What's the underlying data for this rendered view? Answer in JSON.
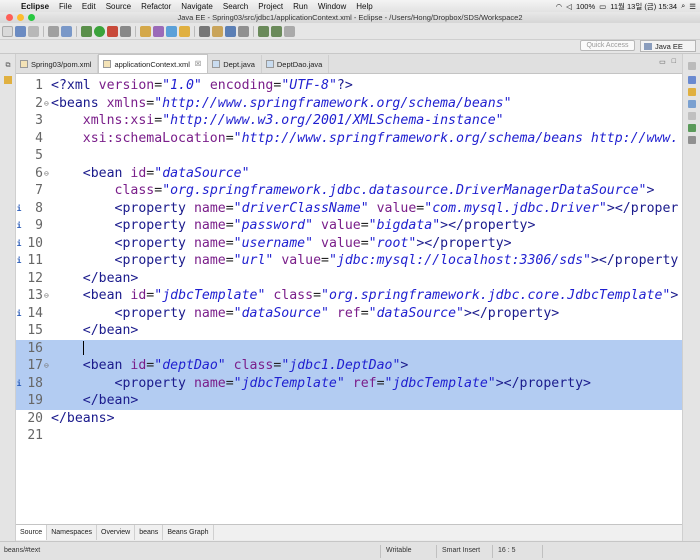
{
  "menubar": {
    "items": [
      "Eclipse",
      "File",
      "Edit",
      "Source",
      "Refactor",
      "Navigate",
      "Search",
      "Project",
      "Run",
      "Window",
      "Help"
    ],
    "battery": "100%",
    "datetime": "11월 13일 (금)  15:34"
  },
  "window": {
    "title": "Java EE - Spring03/src/jdbc1/applicationContext.xml - Eclipse - /Users/Hong/Dropbox/SDS/Workspace2"
  },
  "toolbar": {
    "quick_access_placeholder": "Quick Access",
    "perspective": "Java EE"
  },
  "tabs": [
    {
      "label": "Spring03/pom.xml",
      "icon": "xml-file-icon",
      "active": false
    },
    {
      "label": "applicationContext.xml",
      "icon": "xml-file-icon",
      "active": true,
      "close": "☒"
    },
    {
      "label": "Dept.java",
      "icon": "java-file-icon",
      "active": false
    },
    {
      "label": "DeptDao.java",
      "icon": "java-file-icon",
      "active": false
    }
  ],
  "editor": {
    "lines": [
      {
        "n": "1",
        "fold": "",
        "marker": "",
        "sel": false,
        "code": [
          [
            "tg",
            "<?xml "
          ],
          [
            "at",
            "version"
          ],
          [
            "tx",
            "="
          ],
          [
            "vl",
            "\"1.0\""
          ],
          [
            "tx",
            " "
          ],
          [
            "at",
            "encoding"
          ],
          [
            "tx",
            "="
          ],
          [
            "vl",
            "\"UTF-8\""
          ],
          [
            "tg",
            "?>"
          ]
        ]
      },
      {
        "n": "2",
        "fold": "⊖",
        "marker": "",
        "sel": false,
        "code": [
          [
            "tg",
            "<beans "
          ],
          [
            "at",
            "xmlns"
          ],
          [
            "tx",
            "="
          ],
          [
            "vl",
            "\"http://www.springframework.org/schema/beans\""
          ]
        ]
      },
      {
        "n": "3",
        "fold": "",
        "marker": "",
        "sel": false,
        "code": [
          [
            "tx",
            "    "
          ],
          [
            "at",
            "xmlns:xsi"
          ],
          [
            "tx",
            "="
          ],
          [
            "vl",
            "\"http://www.w3.org/2001/XMLSchema-instance\""
          ]
        ]
      },
      {
        "n": "4",
        "fold": "",
        "marker": "",
        "sel": false,
        "code": [
          [
            "tx",
            "    "
          ],
          [
            "at",
            "xsi:schemaLocation"
          ],
          [
            "tx",
            "="
          ],
          [
            "vl",
            "\"http://www.springframework.org/schema/beans http://www."
          ]
        ]
      },
      {
        "n": "5",
        "fold": "",
        "marker": "",
        "sel": false,
        "code": []
      },
      {
        "n": "6",
        "fold": "⊖",
        "marker": "",
        "sel": false,
        "code": [
          [
            "tx",
            "    "
          ],
          [
            "tg",
            "<bean "
          ],
          [
            "at",
            "id"
          ],
          [
            "tx",
            "="
          ],
          [
            "vl",
            "\"dataSource\""
          ]
        ]
      },
      {
        "n": "7",
        "fold": "",
        "marker": "",
        "sel": false,
        "code": [
          [
            "tx",
            "        "
          ],
          [
            "at",
            "class"
          ],
          [
            "tx",
            "="
          ],
          [
            "vl",
            "\"org.springframework.jdbc.datasource.DriverManagerDataSource\""
          ],
          [
            "tg",
            ">"
          ]
        ]
      },
      {
        "n": "8",
        "fold": "",
        "marker": "i",
        "sel": false,
        "code": [
          [
            "tx",
            "        "
          ],
          [
            "tg",
            "<property "
          ],
          [
            "at",
            "name"
          ],
          [
            "tx",
            "="
          ],
          [
            "vl",
            "\"driverClassName\""
          ],
          [
            "tx",
            " "
          ],
          [
            "at",
            "value"
          ],
          [
            "tx",
            "="
          ],
          [
            "vl",
            "\"com.mysql.jdbc.Driver\""
          ],
          [
            "tg",
            "></proper"
          ]
        ]
      },
      {
        "n": "9",
        "fold": "",
        "marker": "i",
        "sel": false,
        "code": [
          [
            "tx",
            "        "
          ],
          [
            "tg",
            "<property "
          ],
          [
            "at",
            "name"
          ],
          [
            "tx",
            "="
          ],
          [
            "vl",
            "\"password\""
          ],
          [
            "tx",
            " "
          ],
          [
            "at",
            "value"
          ],
          [
            "tx",
            "="
          ],
          [
            "vl",
            "\"bigdata\""
          ],
          [
            "tg",
            "></property>"
          ]
        ]
      },
      {
        "n": "10",
        "fold": "",
        "marker": "i",
        "sel": false,
        "code": [
          [
            "tx",
            "        "
          ],
          [
            "tg",
            "<property "
          ],
          [
            "at",
            "name"
          ],
          [
            "tx",
            "="
          ],
          [
            "vl",
            "\"username\""
          ],
          [
            "tx",
            " "
          ],
          [
            "at",
            "value"
          ],
          [
            "tx",
            "="
          ],
          [
            "vl",
            "\"root\""
          ],
          [
            "tg",
            "></property>"
          ]
        ]
      },
      {
        "n": "11",
        "fold": "",
        "marker": "i",
        "sel": false,
        "code": [
          [
            "tx",
            "        "
          ],
          [
            "tg",
            "<property "
          ],
          [
            "at",
            "name"
          ],
          [
            "tx",
            "="
          ],
          [
            "vl",
            "\"url\""
          ],
          [
            "tx",
            " "
          ],
          [
            "at",
            "value"
          ],
          [
            "tx",
            "="
          ],
          [
            "vl",
            "\"jdbc:mysql://localhost:3306/sds\""
          ],
          [
            "tg",
            "></property"
          ]
        ]
      },
      {
        "n": "12",
        "fold": "",
        "marker": "",
        "sel": false,
        "code": [
          [
            "tx",
            "    "
          ],
          [
            "tg",
            "</bean>"
          ]
        ]
      },
      {
        "n": "13",
        "fold": "⊖",
        "marker": "",
        "sel": false,
        "code": [
          [
            "tx",
            "    "
          ],
          [
            "tg",
            "<bean "
          ],
          [
            "at",
            "id"
          ],
          [
            "tx",
            "="
          ],
          [
            "vl",
            "\"jdbcTemplate\""
          ],
          [
            "tx",
            " "
          ],
          [
            "at",
            "class"
          ],
          [
            "tx",
            "="
          ],
          [
            "vl",
            "\"org.springframework.jdbc.core.JdbcTemplate\""
          ],
          [
            "tg",
            ">"
          ]
        ]
      },
      {
        "n": "14",
        "fold": "",
        "marker": "i",
        "sel": false,
        "code": [
          [
            "tx",
            "        "
          ],
          [
            "tg",
            "<property "
          ],
          [
            "at",
            "name"
          ],
          [
            "tx",
            "="
          ],
          [
            "vl",
            "\"dataSource\""
          ],
          [
            "tx",
            " "
          ],
          [
            "at",
            "ref"
          ],
          [
            "tx",
            "="
          ],
          [
            "vl",
            "\"dataSource\""
          ],
          [
            "tg",
            "></property>"
          ]
        ]
      },
      {
        "n": "15",
        "fold": "",
        "marker": "",
        "sel": false,
        "code": [
          [
            "tx",
            "    "
          ],
          [
            "tg",
            "</bean>"
          ]
        ]
      },
      {
        "n": "16",
        "fold": "",
        "marker": "",
        "sel": true,
        "cursor": true,
        "code": [
          [
            "tx",
            "    "
          ]
        ]
      },
      {
        "n": "17",
        "fold": "⊖",
        "marker": "",
        "sel": true,
        "code": [
          [
            "tx",
            "    "
          ],
          [
            "tg",
            "<bean "
          ],
          [
            "at",
            "id"
          ],
          [
            "tx",
            "="
          ],
          [
            "vl",
            "\"deptDao\""
          ],
          [
            "tx",
            " "
          ],
          [
            "at",
            "class"
          ],
          [
            "tx",
            "="
          ],
          [
            "vl",
            "\"jdbc1.DeptDao\""
          ],
          [
            "tg",
            ">"
          ]
        ]
      },
      {
        "n": "18",
        "fold": "",
        "marker": "i",
        "sel": true,
        "code": [
          [
            "tx",
            "        "
          ],
          [
            "tg",
            "<property "
          ],
          [
            "at",
            "name"
          ],
          [
            "tx",
            "="
          ],
          [
            "vl",
            "\"jdbcTemplate\""
          ],
          [
            "tx",
            " "
          ],
          [
            "at",
            "ref"
          ],
          [
            "tx",
            "="
          ],
          [
            "vl",
            "\"jdbcTemplate\""
          ],
          [
            "tg",
            "></property>"
          ]
        ]
      },
      {
        "n": "19",
        "fold": "",
        "marker": "",
        "sel": true,
        "code": [
          [
            "tx",
            "    "
          ],
          [
            "tg",
            "</bean>"
          ]
        ]
      },
      {
        "n": "20",
        "fold": "",
        "marker": "",
        "sel": false,
        "code": [
          [
            "tg",
            "</beans>"
          ]
        ]
      },
      {
        "n": "21",
        "fold": "",
        "marker": "",
        "sel": false,
        "code": []
      }
    ]
  },
  "bottom_tabs": [
    "Source",
    "Namespaces",
    "Overview",
    "beans",
    "Beans Graph"
  ],
  "status": {
    "path": "beans/#text",
    "mode": "Writable",
    "insert": "Smart Insert",
    "position": "16 : 5"
  },
  "colors": {
    "tag": "#1a1a8c",
    "attribute": "#7a1e8a",
    "value": "#1f1fd0",
    "selection": "#b3ccf2"
  }
}
